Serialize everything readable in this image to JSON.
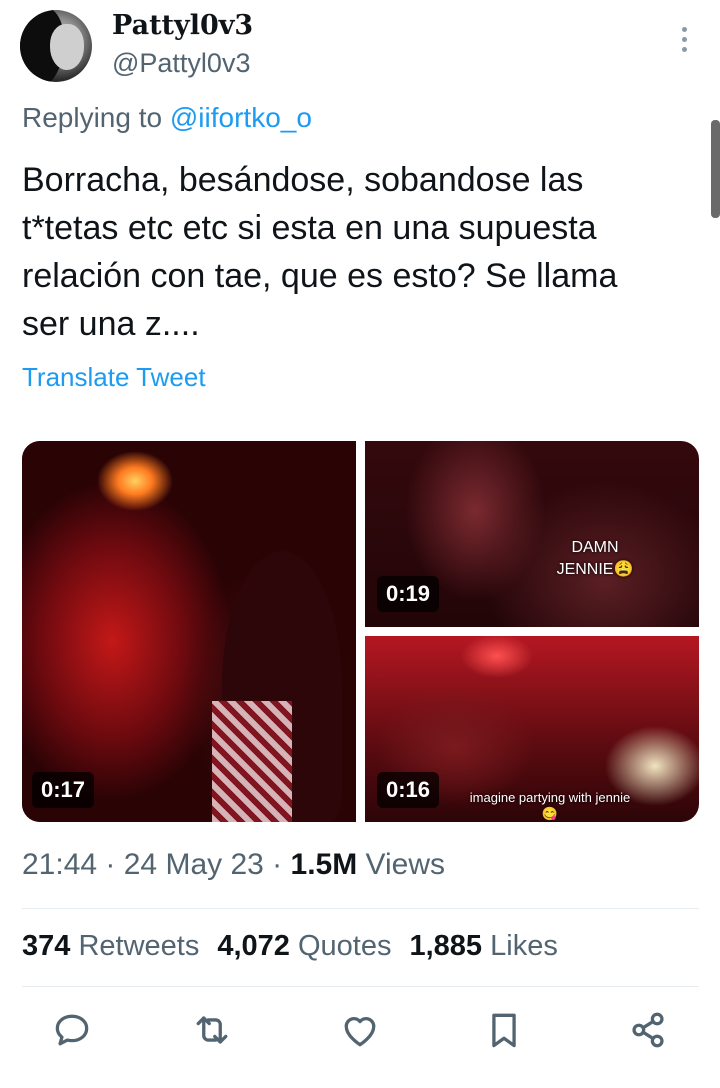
{
  "author": {
    "display_name": "Pattyl0v3",
    "handle": "@Pattyl0v3"
  },
  "reply": {
    "prefix": "Replying to ",
    "to": "@iifortko_o"
  },
  "tweet": {
    "text": "Borracha, besándose, sobandose las\nt*tetas etc etc si esta en una supuesta\nrelación con tae, que es esto? Se llama\nser una z....",
    "translate_label": "Translate Tweet"
  },
  "media": [
    {
      "duration": "0:17",
      "overlay": ""
    },
    {
      "duration": "0:19",
      "overlay": "DAMN JENNIE😩"
    },
    {
      "duration": "0:16",
      "overlay": "imagine partying with jennie 😋"
    }
  ],
  "meta": {
    "time": "21:44",
    "sep1": " · ",
    "date": "24 May 23",
    "sep2": " · ",
    "views_count": "1.5M",
    "views_label": " Views"
  },
  "stats": {
    "retweets_count": "374",
    "retweets_label": " Retweets",
    "quotes_count": "4,072",
    "quotes_label": " Quotes",
    "likes_count": "1,885",
    "likes_label": " Likes"
  },
  "icons": {
    "reply": "comment-icon",
    "retweet": "retweet-icon",
    "like": "heart-icon",
    "bookmark": "bookmark-icon",
    "share": "share-icon",
    "more": "more-options-icon"
  },
  "colors": {
    "link": "#1d9bf0",
    "secondary_text": "#536471",
    "primary_text": "#0f1419"
  }
}
